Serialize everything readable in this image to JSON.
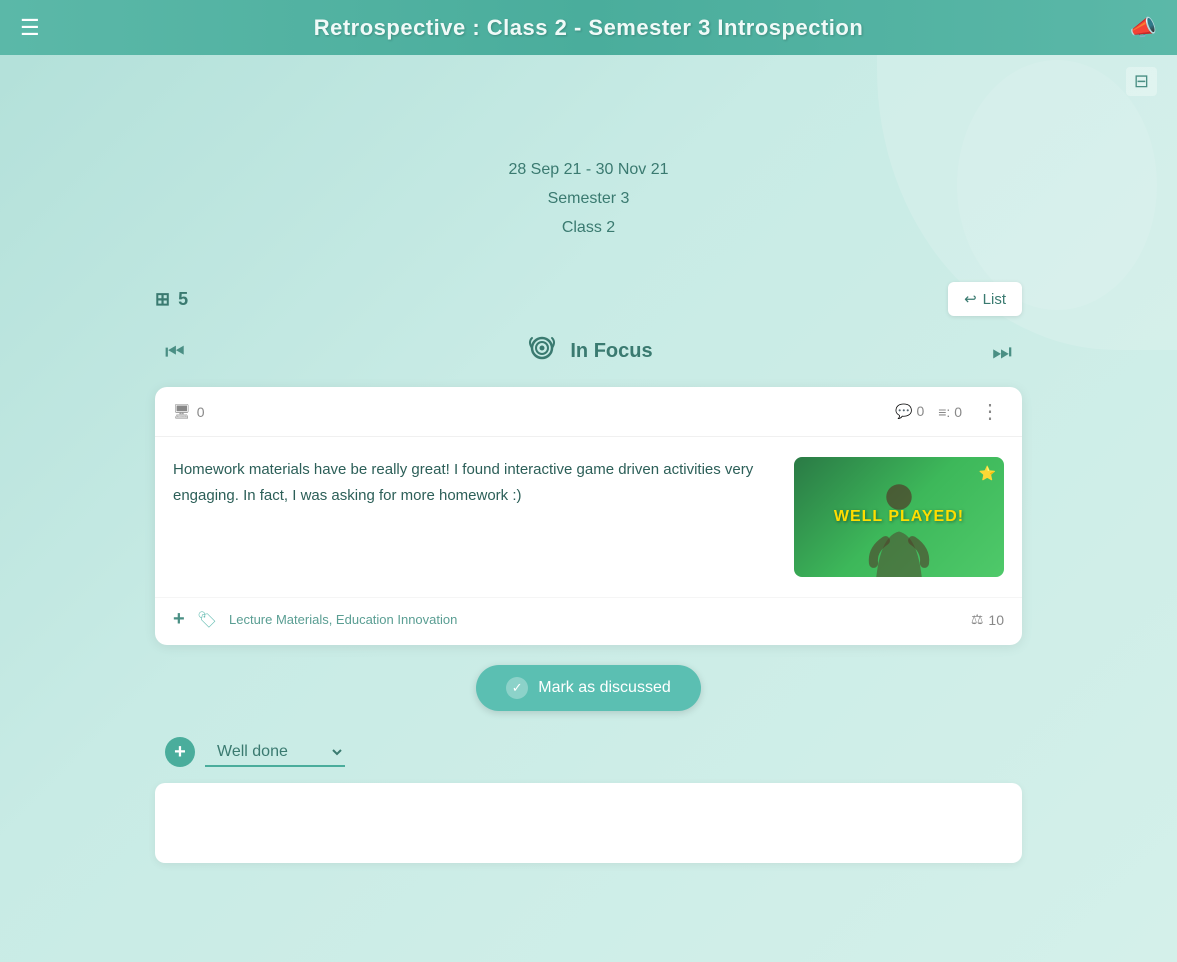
{
  "header": {
    "title": "Retrospective : Class 2 - Semester 3 Introspection",
    "menu_label": "☰",
    "announce_icon": "📣"
  },
  "filter": {
    "icon": "⊟"
  },
  "date_info": {
    "date_range": "28 Sep 21 - 30 Nov 21",
    "semester": "Semester 3",
    "class": "Class 2"
  },
  "content": {
    "stack_count": "5",
    "list_button_label": "List",
    "nav": {
      "prev_label": "⏮",
      "next_label": "⏭",
      "section_label": "In Focus"
    },
    "card": {
      "vote_count": "0",
      "comment_count": "0",
      "action_count": "0",
      "text": "Homework materials have be really great! I found interactive game driven activities very engaging. In fact, I was asking for more homework :)",
      "image_text": "WELL PLAYED!",
      "tags": "Lecture Materials, Education Innovation",
      "score": "10",
      "mark_discussed_label": "Mark as discussed"
    },
    "well_done": {
      "plus_label": "+",
      "dropdown_label": "Well done",
      "dropdown_arrow": "▾"
    }
  }
}
